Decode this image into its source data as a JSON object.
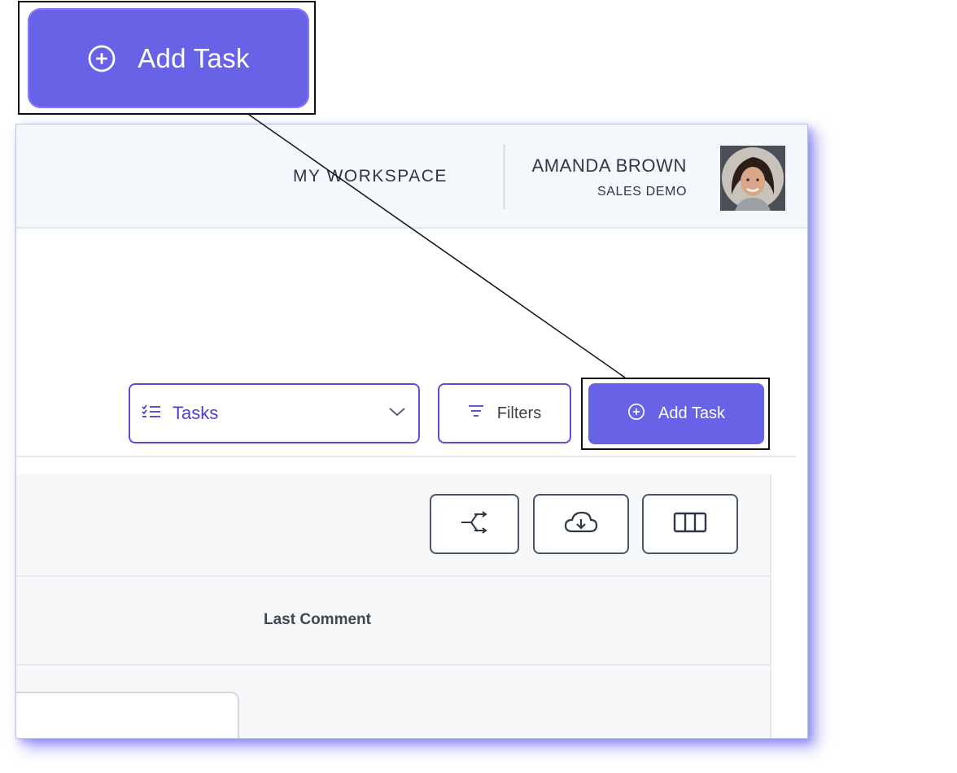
{
  "callout": {
    "label": "Add Task",
    "icon": "plus-circle-icon"
  },
  "header": {
    "workspace": "MY WORKSPACE",
    "user_name": "AMANDA BROWN",
    "user_org": "SALES DEMO",
    "avatar": "user-avatar"
  },
  "toolbar": {
    "view_select": {
      "icon": "checklist-icon",
      "value": "Tasks",
      "chevron": "chevron-down-icon"
    },
    "filters": {
      "label": "Filters",
      "icon": "filter-icon"
    },
    "add_task": {
      "label": "Add Task",
      "icon": "plus-circle-icon"
    }
  },
  "grid": {
    "actions": [
      {
        "name": "share-icon"
      },
      {
        "name": "cloud-download-icon"
      },
      {
        "name": "columns-icon"
      }
    ],
    "columns": [
      "Last Comment"
    ]
  },
  "colors": {
    "accent": "#6862e6",
    "accent_border": "#5c4fd6",
    "header_bg": "#f4f8fc"
  }
}
